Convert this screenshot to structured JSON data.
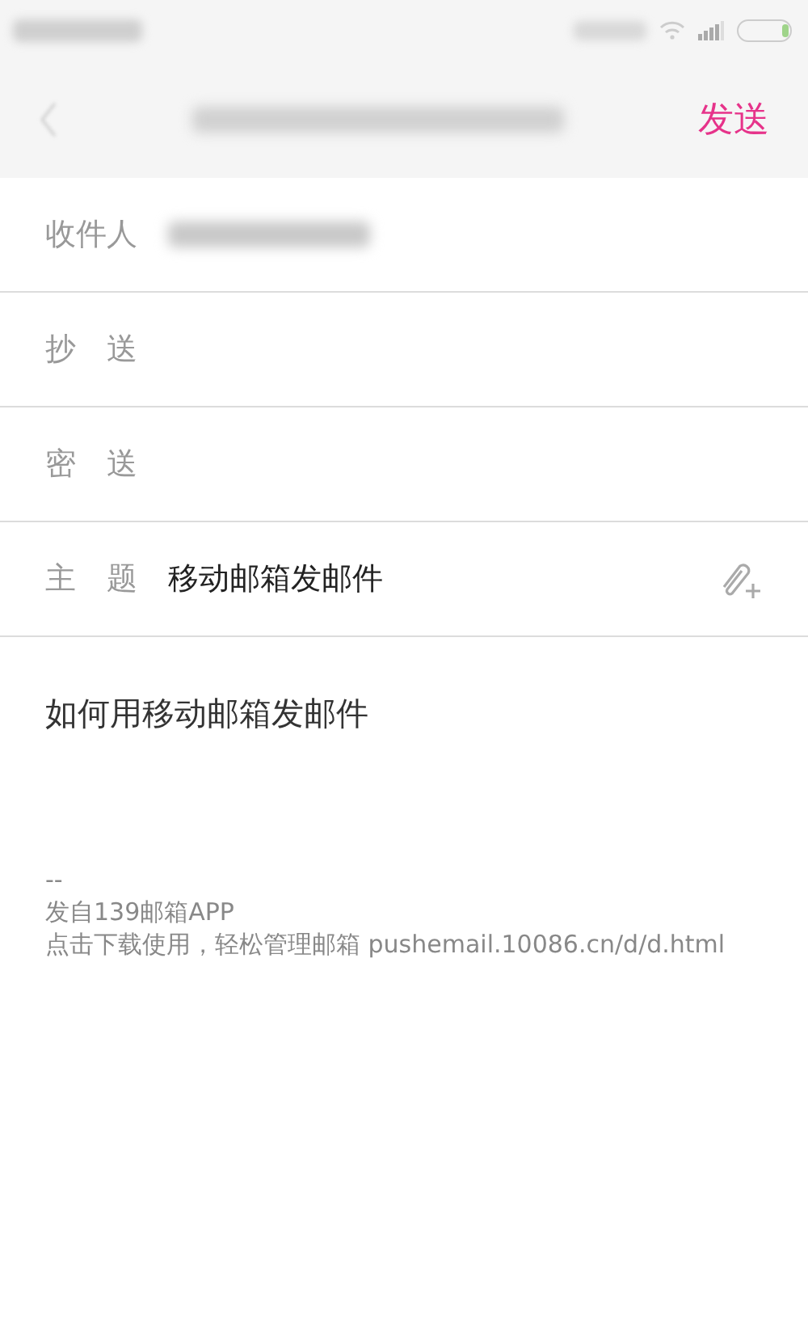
{
  "header": {
    "send": "发送"
  },
  "fields": [
    {
      "kind": "recipient",
      "label": "收件人"
    },
    {
      "kind": "plain",
      "label": "抄　送"
    },
    {
      "kind": "plain",
      "label": "密　送"
    },
    {
      "kind": "subject",
      "label": "主　题",
      "value": "移动邮箱发邮件"
    }
  ],
  "body": "如何用移动邮箱发邮件",
  "signature": [
    "--",
    "发自139邮箱APP",
    "点击下载使用，轻松管理邮箱 pushemail.10086.cn/d/d.html"
  ]
}
